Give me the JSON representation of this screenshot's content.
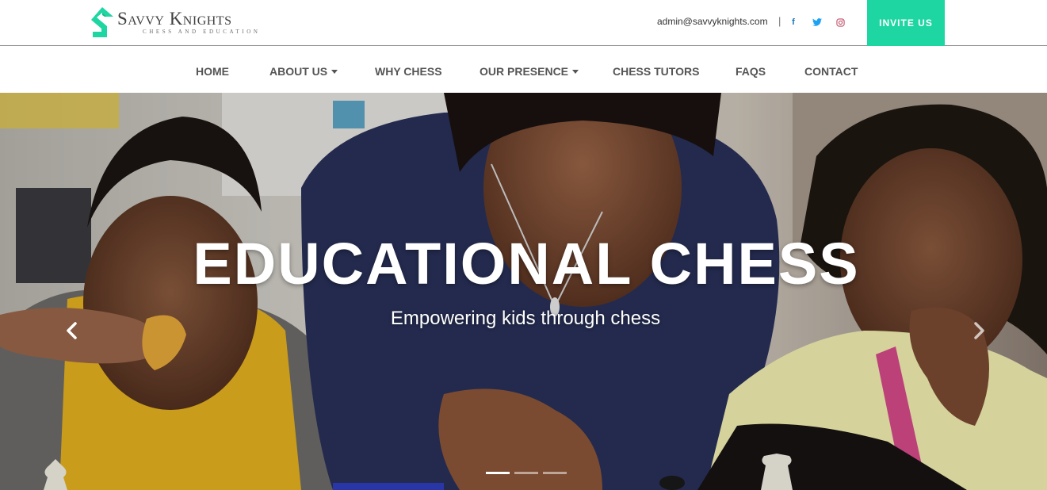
{
  "brand": {
    "name": "Savvy Knights",
    "tagline": "Chess and Education",
    "accent_color": "#1ed6a2"
  },
  "topbar": {
    "email": "admin@savvyknights.com",
    "separator": "|",
    "social": [
      {
        "icon": "facebook-icon",
        "glyph": "f"
      },
      {
        "icon": "twitter-icon"
      },
      {
        "icon": "instagram-icon"
      }
    ],
    "invite_label": "INVITE US"
  },
  "nav": {
    "items": [
      {
        "label": "HOME",
        "dropdown": false
      },
      {
        "label": "ABOUT US",
        "dropdown": true
      },
      {
        "label": "WHY CHESS",
        "dropdown": false
      },
      {
        "label": "OUR PRESENCE",
        "dropdown": true
      },
      {
        "label": "CHESS TUTORS",
        "dropdown": false
      },
      {
        "label": "FAQS",
        "dropdown": false
      },
      {
        "label": "CONTACT",
        "dropdown": false
      }
    ]
  },
  "hero": {
    "title": "EDUCATIONAL CHESS",
    "subtitle": "Empowering kids through chess",
    "prev_icon": "chevron-left-icon",
    "next_icon": "chevron-right-icon",
    "slides_count": 3,
    "active_slide": 1
  }
}
